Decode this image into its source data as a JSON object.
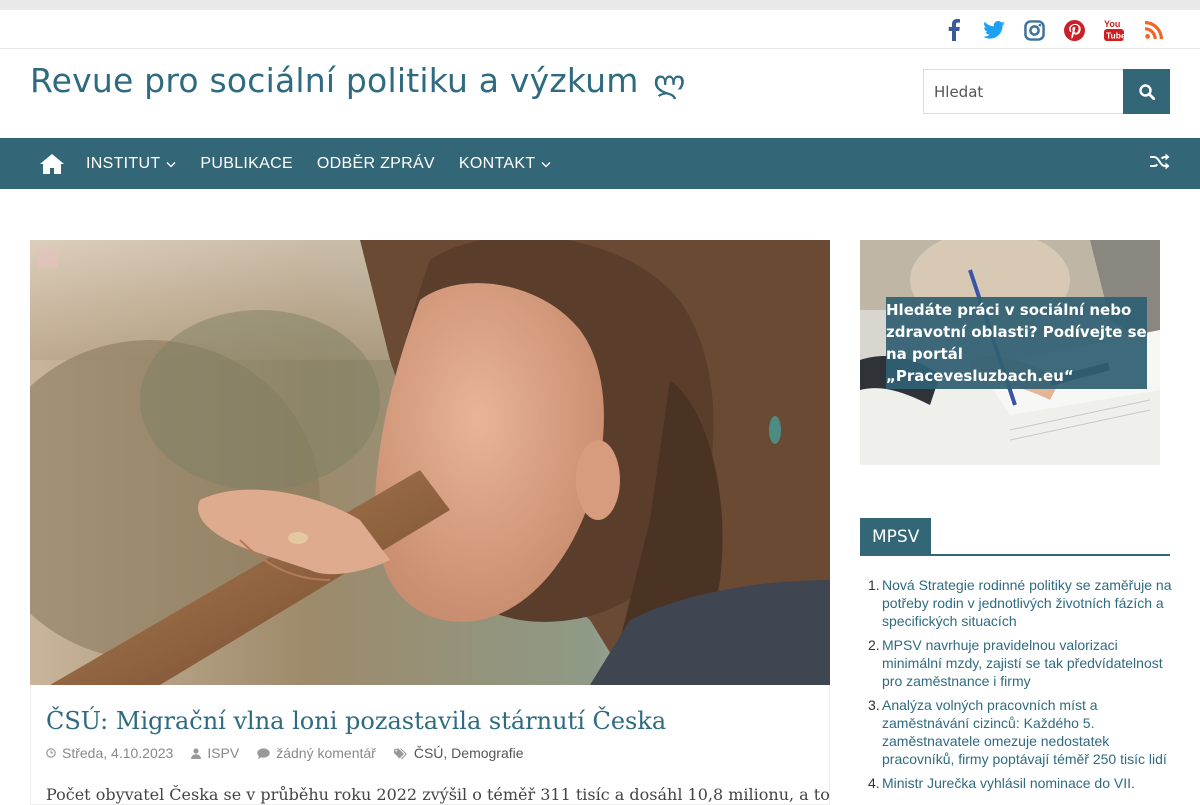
{
  "social": {
    "icons": [
      "facebook-icon",
      "twitter-icon",
      "instagram-icon",
      "pinterest-icon",
      "youtube-icon",
      "rss-icon"
    ],
    "colors": {
      "facebook": "#3b5998",
      "twitter": "#1da1f2",
      "instagram": "#3f729b",
      "pinterest": "#cb2027",
      "youtube": "#cd201f",
      "rss": "#f26522"
    }
  },
  "header": {
    "site_title": "Revue pro sociální politiku a výzkum",
    "title_glyph": "ლ",
    "search_placeholder": "Hledat"
  },
  "nav": {
    "items": [
      {
        "label": "INSTITUT",
        "has_submenu": true
      },
      {
        "label": "PUBLIKACE",
        "has_submenu": false
      },
      {
        "label": "ODBĚR ZPRÁV",
        "has_submenu": false
      },
      {
        "label": "KONTAKT",
        "has_submenu": true
      }
    ]
  },
  "post": {
    "title": "ČSÚ: Migrační vlna loni pozastavila stárnutí Česka",
    "date": "Středa, 4.10.2023",
    "author": "ISPV",
    "comments": "žádný komentář",
    "categories": [
      "ČSÚ",
      "Demografie"
    ],
    "excerpt": "Počet obyvatel Česka se v průběhu roku 2022 zvýšil o téměř 311 tisíc a dosáhl 10,8 milionu, a to"
  },
  "sidebar": {
    "ad_text": "Hledáte práci v sociální nebo zdravotní oblasti? Podívejte se na portál „Pracevesluzbach.eu“",
    "widget_title": "MPSV",
    "mpsv_items": [
      "Nová Strategie rodinné politiky se zaměřuje na potřeby rodin v jednotlivých životních fázích a specifických situacích",
      "MPSV navrhuje pravidelnou valorizaci minimální mzdy, zajistí se tak předvídatelnost pro zaměstnance i firmy",
      "Analýza volných pracovních míst a zaměstnávání cizinců: Každého 5. zaměstnavatele omezuje nedostatek pracovníků, firmy poptávají téměř 250 tisíc lidí",
      "Ministr Jurečka vyhlásil nominace do VII."
    ]
  },
  "colors": {
    "brand": "#336778",
    "title": "#2f6b80"
  }
}
